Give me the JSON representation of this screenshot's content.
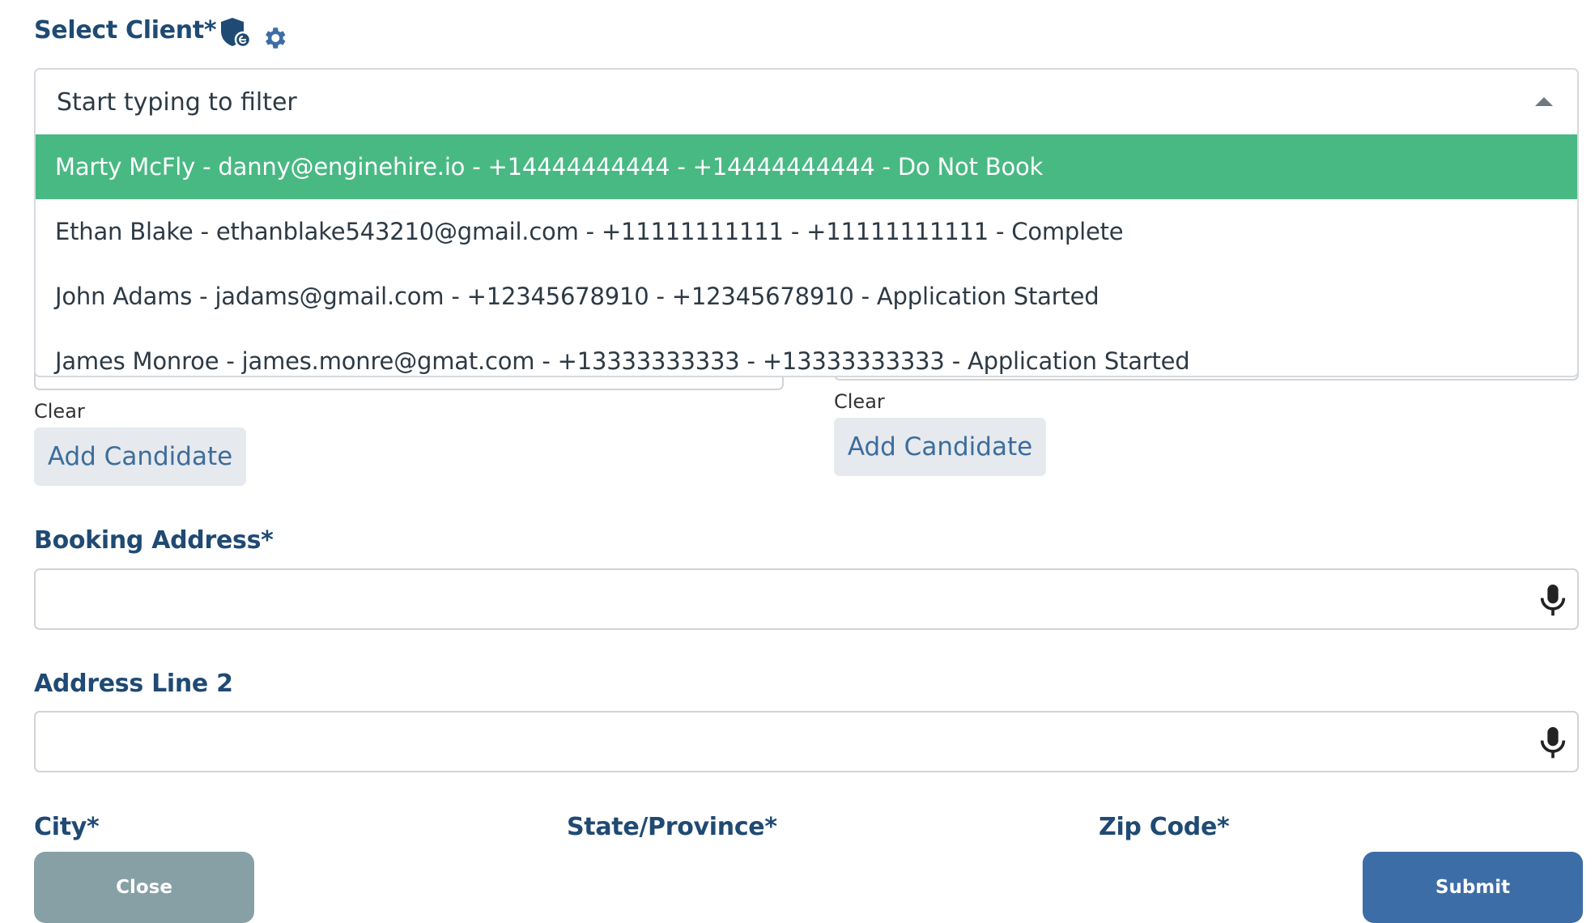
{
  "select_client": {
    "label": "Select Client*",
    "placeholder": "Start typing to filter"
  },
  "options": [
    {
      "text": "Marty McFly - danny@enginehire.io - +14444444444 - +14444444444 - Do Not Book",
      "selected": true
    },
    {
      "text": "Ethan Blake - ethanblake543210@gmail.com - +11111111111 - +11111111111 - Complete",
      "selected": false
    },
    {
      "text": "John Adams - jadams@gmail.com - +12345678910 - +12345678910 - Application Started",
      "selected": false
    },
    {
      "text": "James Monroe - james.monre@gmat.com - +13333333333 - +13333333333 - Application Started",
      "selected": false
    }
  ],
  "candidates": {
    "left": {
      "clear": "Clear",
      "add": "Add Candidate"
    },
    "right": {
      "clear": "Clear",
      "add": "Add Candidate"
    }
  },
  "booking_address": {
    "label": "Booking Address*"
  },
  "address_line_2": {
    "label": "Address Line 2"
  },
  "city": {
    "label": "City*"
  },
  "state": {
    "label": "State/Province*"
  },
  "zip": {
    "label": "Zip Code*"
  },
  "buttons": {
    "close": "Close",
    "submit": "Submit"
  },
  "colors": {
    "heading": "#1f4a73",
    "selected_option": "#48b983",
    "submit": "#3d6da6",
    "close": "#86a0a6",
    "add_candidate_bg": "#e6e9ed"
  }
}
